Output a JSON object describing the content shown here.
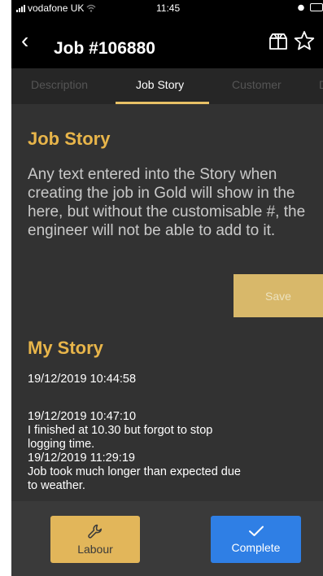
{
  "status_bar": {
    "carrier": "vodafone UK",
    "time": "11:45"
  },
  "header": {
    "back_glyph": "‹",
    "title": "Job #106880",
    "icons": [
      "package-icon",
      "star-icon"
    ]
  },
  "tabs": [
    {
      "label": "Description"
    },
    {
      "label": "Job Story",
      "active": true
    },
    {
      "label": "Customer"
    },
    {
      "label": "D"
    }
  ],
  "job_story": {
    "title": "Job Story",
    "text": "Any text entered into the Story when creating the job in Gold will show in the here, but without the customisable #, the engineer will not be able to add to it.",
    "save_label": "Save"
  },
  "my_story": {
    "title": "My Story",
    "entries": [
      "19/12/2019 10:44:58",
      "19/12/2019 10:47:10\nI finished at 10.30 but forgot to stop\nlogging time.\n19/12/2019 11:29:19\nJob took much longer than expected due\nto weather."
    ]
  },
  "actions": {
    "labour_label": "Labour",
    "complete_label": "Complete"
  },
  "colors": {
    "accent_gold": "#e8b54a",
    "complete_blue": "#2f7fe5",
    "background": "#323232"
  }
}
